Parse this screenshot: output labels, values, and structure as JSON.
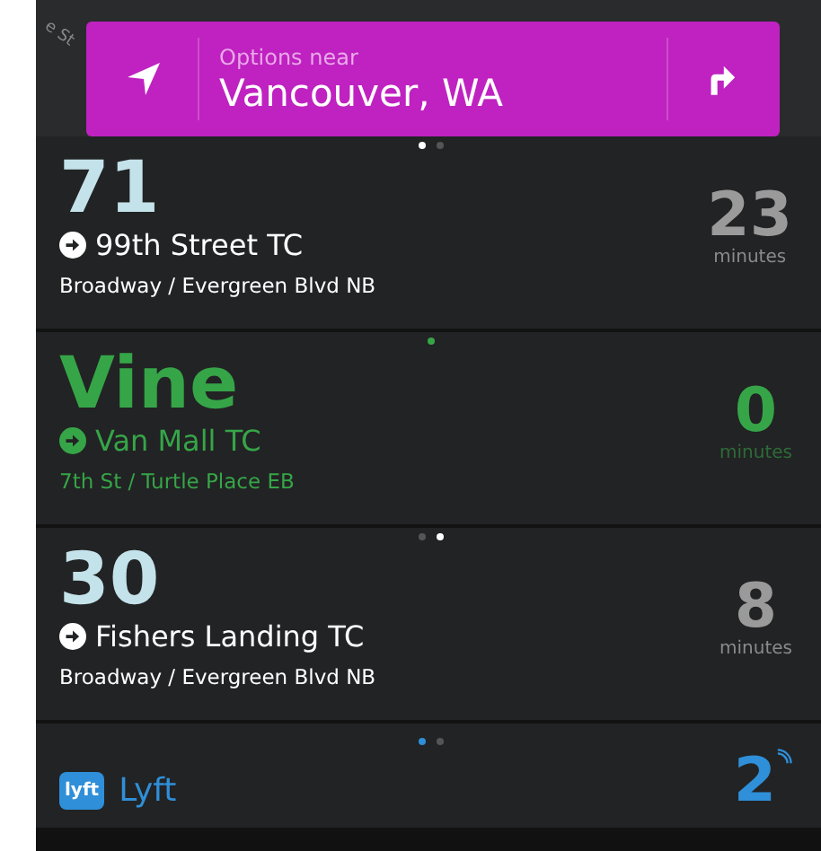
{
  "map": {
    "street_label": "e St"
  },
  "location_bar": {
    "caption": "Options near",
    "place": "Vancouver, WA"
  },
  "cards": [
    {
      "kind": "transit",
      "route": "71",
      "color": "#c4e2ea",
      "themed": false,
      "destination": "99th Street TC",
      "stop": "Broadway / Evergreen Blvd NB",
      "minutes": "23",
      "unit": "minutes",
      "dots": [
        {
          "selected": true
        },
        {
          "selected": false
        }
      ]
    },
    {
      "kind": "transit",
      "route": "Vine",
      "color": "#36a548",
      "themed": true,
      "destination": "Van Mall TC",
      "stop": "7th St / Turtle Place EB",
      "minutes": "0",
      "unit": "minutes",
      "dots": [
        {
          "selected": true
        }
      ]
    },
    {
      "kind": "transit",
      "route": "30",
      "color": "#c4e2ea",
      "themed": false,
      "destination": "Fishers Landing TC",
      "stop": "Broadway / Evergreen Blvd NB",
      "minutes": "8",
      "unit": "minutes",
      "dots": [
        {
          "selected": false
        },
        {
          "selected": true
        }
      ]
    },
    {
      "kind": "rideshare",
      "route": "Lyft",
      "logo": "lyft",
      "color": "#2f8fd8",
      "themed": true,
      "minutes": "2",
      "dots": [
        {
          "selected": true
        },
        {
          "selected": false
        }
      ]
    }
  ]
}
